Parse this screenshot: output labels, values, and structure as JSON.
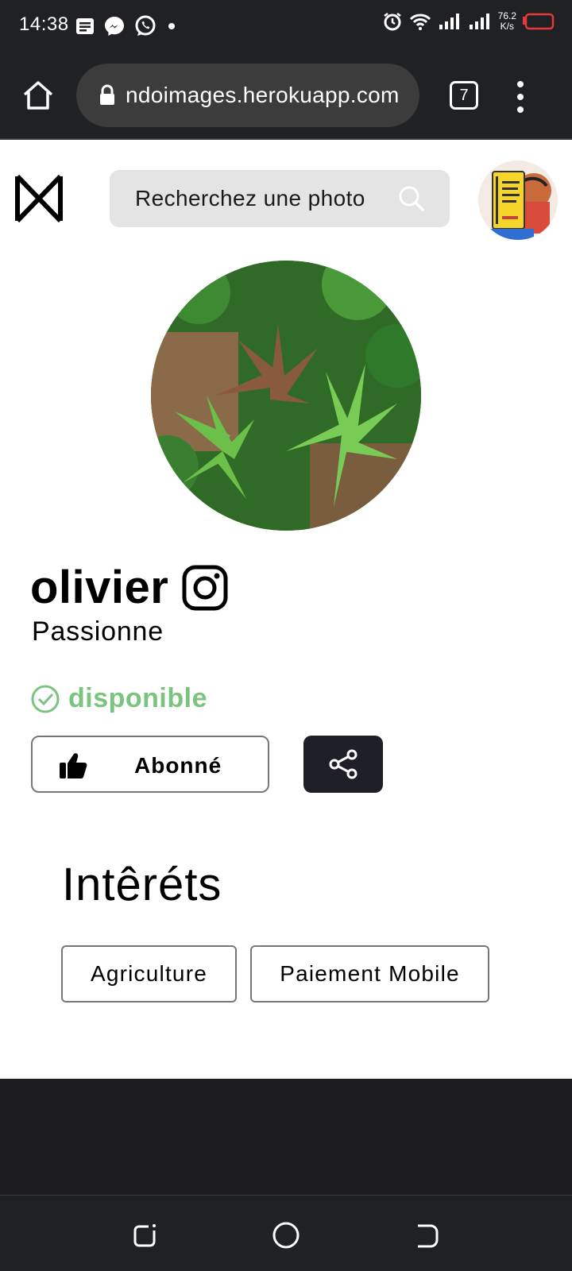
{
  "status_bar": {
    "time": "14:38",
    "speed_value": "76.2",
    "speed_unit": "K/s",
    "icons": [
      "notes-icon",
      "messenger-icon",
      "whatsapp-icon",
      "dot-icon",
      "alarm-icon",
      "wifi-icon",
      "signal-icon",
      "signal-icon",
      "battery-icon"
    ]
  },
  "browser": {
    "url": "ndoimages.herokuapp.com",
    "tab_count": "7"
  },
  "header": {
    "search_placeholder": "Recherchez une photo"
  },
  "profile": {
    "name": "olivier",
    "subtitle": "Passionne",
    "status": "disponible",
    "status_color": "#7bc47f",
    "follow_label": "Abonné"
  },
  "interests": {
    "title": "Intêréts",
    "items": [
      "Agriculture",
      "Paiement Mobile"
    ]
  }
}
